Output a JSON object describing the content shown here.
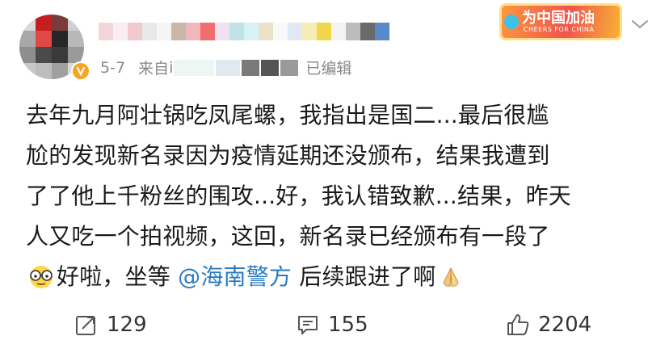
{
  "post": {
    "date": "5-7",
    "source_prefix": "来自",
    "source_visible_char": "i",
    "edited_label": "已编辑",
    "text_line1": "去年九月阿壮锅吃凤尾螺，我指出是国二...最后很尴",
    "text_line2": "尬的发现新名录因为疫情延期还没颁布，结果我遭到",
    "text_line3": "了了他上千粉丝的围攻...好，我认错致歉...结果，昨天",
    "text_line4": "人又吃一个拍视频，这回，新名录已经颁布有一段了",
    "text_line5_a": "好啦，坐等",
    "mention": "@海南警方",
    "text_line5_b": "后续跟进了啊"
  },
  "banner": {
    "title": "为中国加油",
    "subtitle": "CHEERS FOR CHINA"
  },
  "actions": {
    "repost_count": "129",
    "comment_count": "155",
    "like_count": "2204"
  },
  "colors": {
    "mention": "#2a7bc6",
    "meta_gray": "#8a8a8a",
    "verified_badge": "#f5a623"
  }
}
